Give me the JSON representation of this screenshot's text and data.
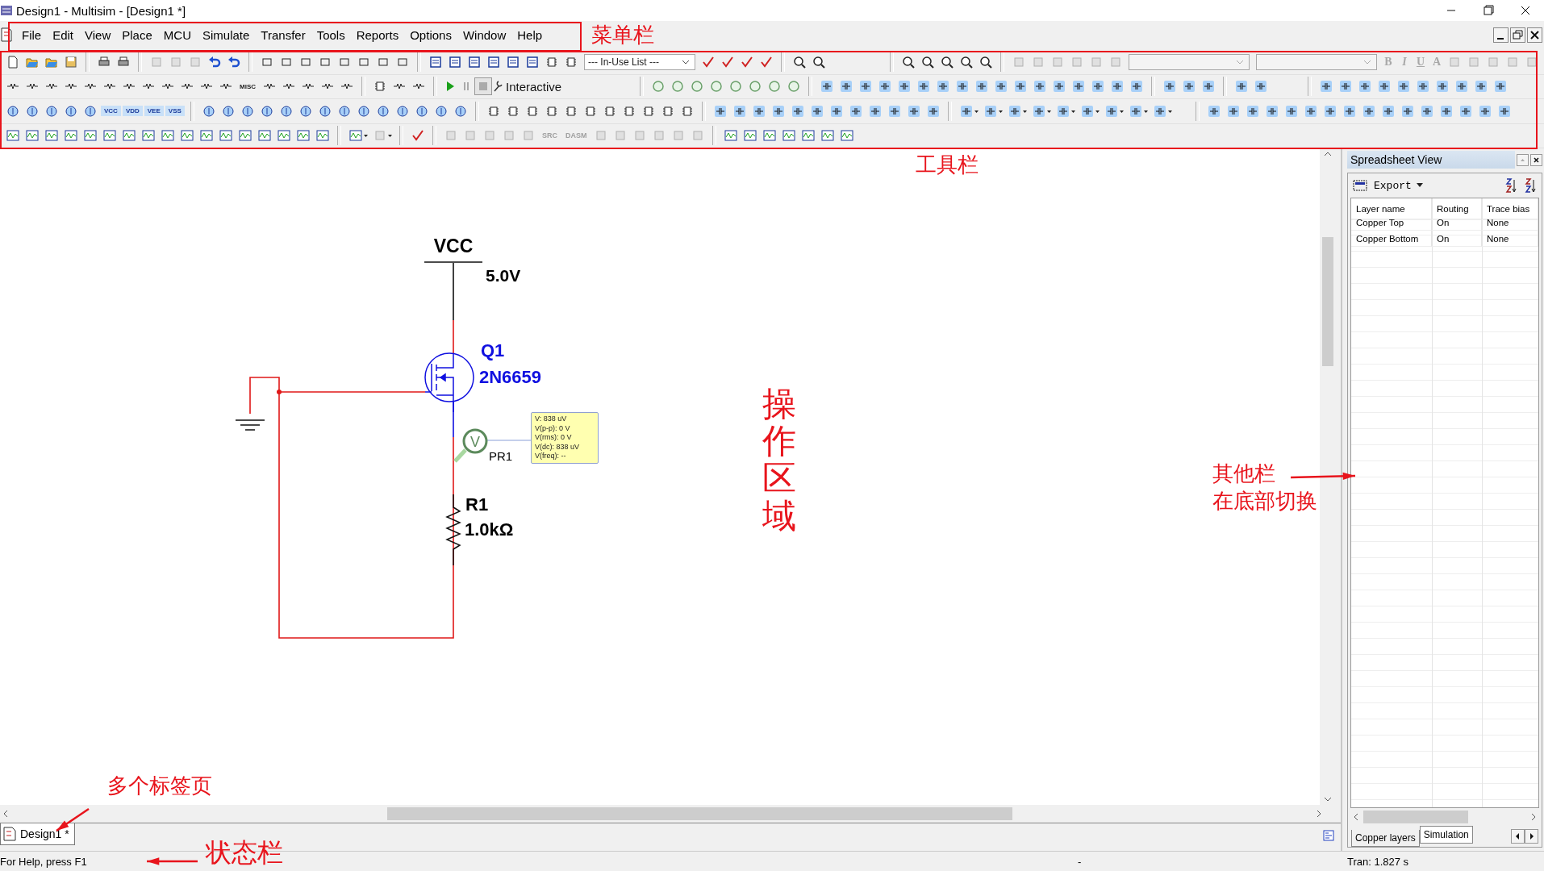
{
  "window": {
    "title": "Design1 - Multisim - [Design1 *]"
  },
  "menu": [
    {
      "label": "File"
    },
    {
      "label": "Edit"
    },
    {
      "label": "View"
    },
    {
      "label": "Place"
    },
    {
      "label": "MCU"
    },
    {
      "label": "Simulate"
    },
    {
      "label": "Transfer"
    },
    {
      "label": "Tools"
    },
    {
      "label": "Reports"
    },
    {
      "label": "Options"
    },
    {
      "label": "Window"
    },
    {
      "label": "Help"
    }
  ],
  "toolbar": {
    "in_use_list": "--- In-Use List ---",
    "mode": "Interactive",
    "misc": "MISC",
    "power_labels": [
      "VCC",
      "VDD",
      "VEE",
      "VSS"
    ],
    "debug_labels": [
      "SRC",
      "DASM"
    ],
    "format_buttons": [
      {
        "label": "B",
        "disabled": true
      },
      {
        "label": "I",
        "disabled": true
      },
      {
        "label": "U",
        "disabled": true
      },
      {
        "label": "A",
        "disabled": true
      }
    ]
  },
  "schematic": {
    "supply_name": "VCC",
    "supply_value": "5.0V",
    "transistor_ref": "Q1",
    "transistor_model": "2N6659",
    "probe_ref": "PR1",
    "probe_letter": "V",
    "resistor_ref": "R1",
    "resistor_value": "1.0kΩ",
    "probe_readings": [
      "V: 838 uV",
      "V(p-p): 0 V",
      "V(rms): 0 V",
      "V(dc): 838 uV",
      "V(freq): --"
    ]
  },
  "document_tabs": [
    {
      "label": "Design1 *",
      "selected": true
    }
  ],
  "spreadsheet": {
    "title": "Spreadsheet View",
    "export": "Export",
    "columns": [
      "Layer name",
      "Routing",
      "Trace bias"
    ],
    "rows": [
      [
        "Copper Top",
        "On",
        "None"
      ],
      [
        "Copper Bottom",
        "On",
        "None"
      ]
    ],
    "tabs": [
      {
        "label": "Copper layers",
        "selected": false
      },
      {
        "label": "Simulation",
        "selected": true
      }
    ]
  },
  "status_bar": {
    "help": "For Help, press F1",
    "indicator": "-",
    "simulation": "Tran: 1.827 s"
  },
  "annotations": [
    {
      "text": "菜单栏",
      "kind": "horizontal"
    },
    {
      "text": "工具栏",
      "kind": "horizontal"
    },
    {
      "text": "操作区域",
      "kind": "vertical"
    },
    {
      "text": "其他栏",
      "kind": "horizontal"
    },
    {
      "text": "在底部切换",
      "kind": "horizontal"
    },
    {
      "text": "多个标签页",
      "kind": "horizontal"
    },
    {
      "text": "状态栏",
      "kind": "horizontal"
    }
  ]
}
